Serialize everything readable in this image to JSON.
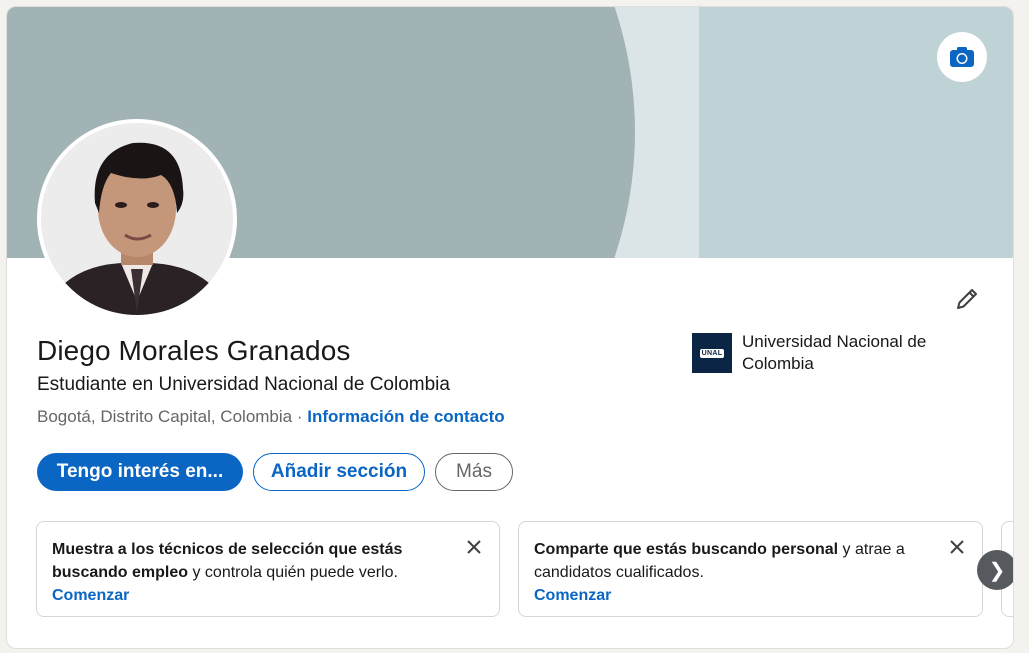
{
  "profile": {
    "name": "Diego Morales Granados",
    "headline": "Estudiante en Universidad Nacional de Colombia",
    "location": "Bogotá, Distrito Capital, Colombia",
    "separator": "·",
    "contact_link": "Información de contacto"
  },
  "education": {
    "logo_text": "UNAL",
    "name": "Universidad Nacional de Colombia"
  },
  "actions": {
    "primary": "Tengo interés en...",
    "secondary": "Añadir sección",
    "more": "Más"
  },
  "suggestions": [
    {
      "bold": "Muestra a los técnicos de selección que estás buscando empleo",
      "rest": " y controla quién puede verlo.",
      "link": "Comenzar"
    },
    {
      "bold": "Comparte que estás buscando personal",
      "rest": " y atrae a candidatos cualificados.",
      "link": "Comenzar"
    }
  ],
  "icons": {
    "camera": "camera-icon",
    "edit": "pencil-icon",
    "close": "close-icon",
    "next": "chevron-right-icon"
  },
  "colors": {
    "accent": "#0a66c2",
    "cover": "#bfd3d6",
    "cover_arc": "#a1b3b5"
  }
}
